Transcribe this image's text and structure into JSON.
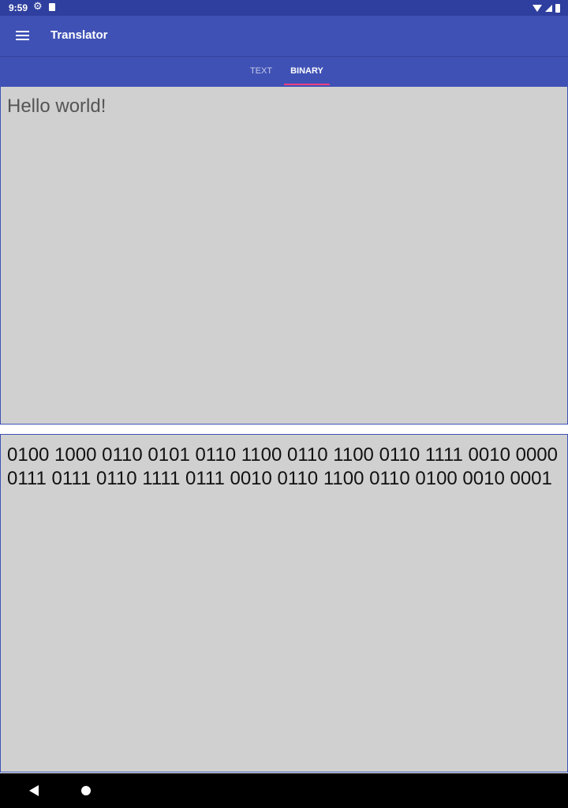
{
  "status_bar": {
    "time": "9:59",
    "icons": [
      "settings-icon",
      "sd-card-icon",
      "wifi-icon",
      "signal-icon",
      "battery-icon"
    ]
  },
  "app_bar": {
    "title": "Translator",
    "menu_icon": "menu-icon"
  },
  "tabs": {
    "items": [
      {
        "label": "TEXT",
        "selected": false
      },
      {
        "label": "BINARY",
        "selected": true
      }
    ]
  },
  "input_panel": {
    "value": "Hello world!"
  },
  "output_panel": {
    "value": "0100 1000 0110 0101 0110 1100 0110 1100 0110 1111 0010 0000 0111 0111 0110 1111 0111 0010 0110 1100 0110 0100 0010 0001"
  },
  "nav_bar": {
    "icons": [
      "back-icon",
      "home-icon"
    ]
  },
  "colors": {
    "primary": "#3f51b5",
    "primary_dark": "#2f3f9f",
    "accent": "#ff4081",
    "panel_bg": "#d0d0d0"
  }
}
